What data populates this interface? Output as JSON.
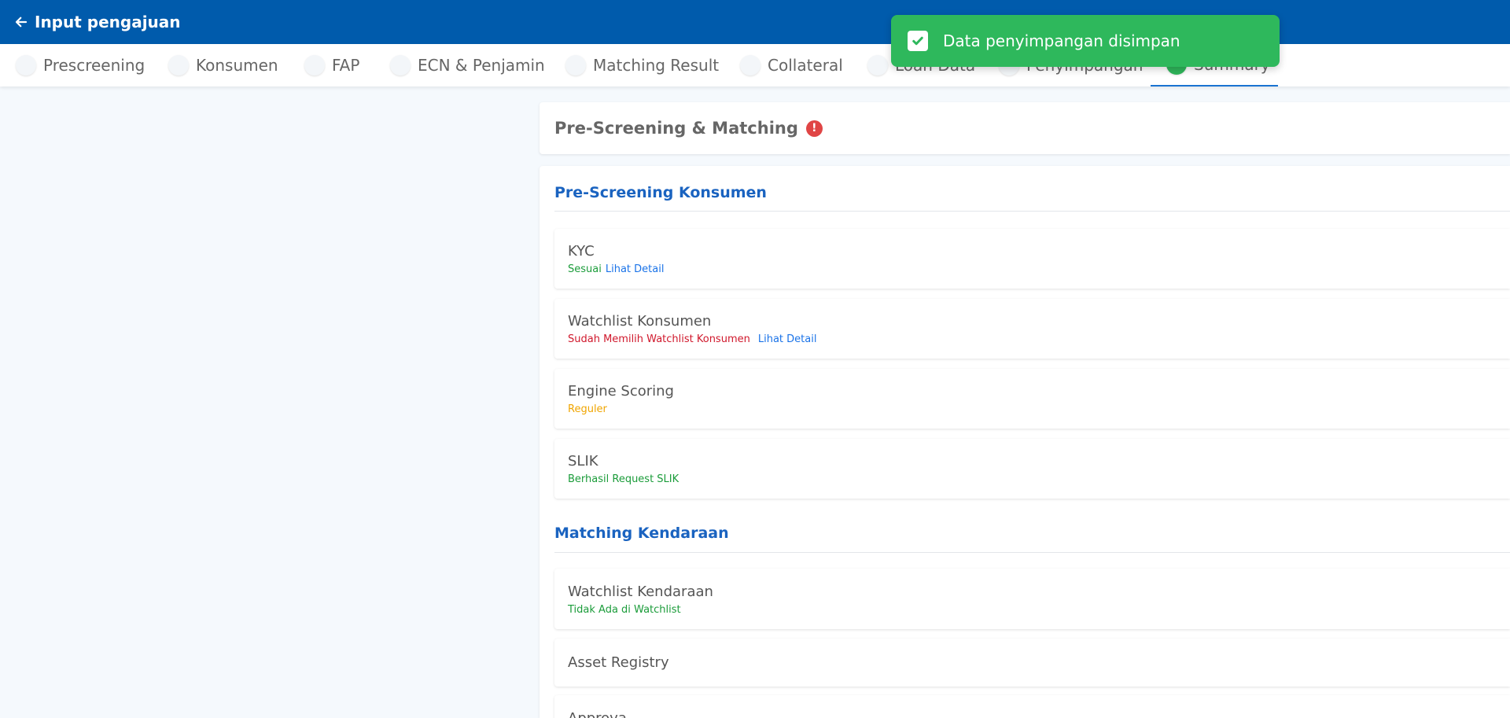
{
  "topbar": {
    "title": "Input pengajuan"
  },
  "steps": [
    {
      "label": "Prescreening"
    },
    {
      "label": "Konsumen"
    },
    {
      "label": "FAP"
    },
    {
      "label": "ECN & Penjamin"
    },
    {
      "label": "Matching Result"
    },
    {
      "label": "Collateral"
    },
    {
      "label": "Loan Data"
    },
    {
      "label": "Penyimpangan"
    },
    {
      "label": "Summary"
    }
  ],
  "toast": {
    "message": "Data penyimpangan disimpan"
  },
  "header": {
    "title": "Pre-Screening & Matching"
  },
  "sections": {
    "prescreening": {
      "title": "Pre-Screening Konsumen",
      "items": [
        {
          "title": "KYC",
          "status": "Sesuai",
          "link": "Lihat Detail"
        },
        {
          "title": "Watchlist Konsumen",
          "status": "Sudah Memilih Watchlist Konsumen",
          "link": "Lihat Detail"
        },
        {
          "title": "Engine Scoring",
          "status": "Reguler"
        },
        {
          "title": "SLIK",
          "status": "Berhasil Request SLIK"
        }
      ]
    },
    "matching": {
      "title": "Matching Kendaraan",
      "items": [
        {
          "title": "Watchlist Kendaraan",
          "status": "Tidak Ada di Watchlist"
        },
        {
          "title": "Asset Registry"
        },
        {
          "title": "Approva"
        }
      ]
    }
  },
  "colors": {
    "primary": "#005bac",
    "success": "#2eb85c",
    "danger": "#d0182c",
    "warning": "#f0a500",
    "link": "#1a73e8"
  }
}
